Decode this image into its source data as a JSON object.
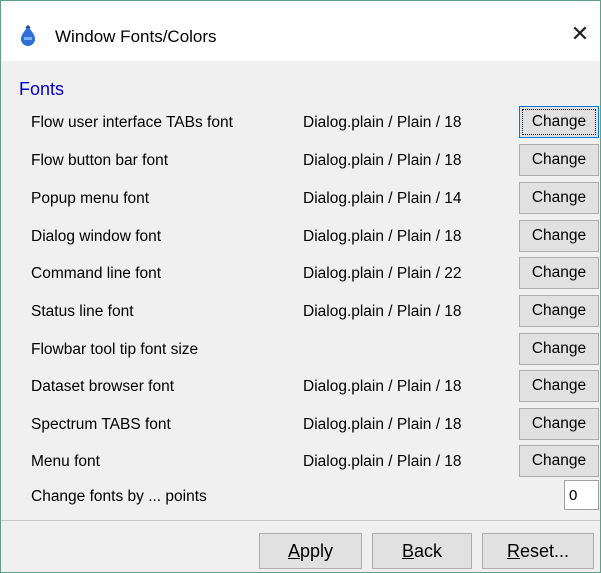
{
  "window": {
    "title": "Window Fonts/Colors",
    "close_glyph": "✕",
    "icon": "droplet-icon"
  },
  "section": {
    "title": "Fonts"
  },
  "rows": [
    {
      "label": "Flow user interface TABs font",
      "value": "Dialog.plain / Plain / 18",
      "button": "Change",
      "focused": true
    },
    {
      "label": "Flow button bar font",
      "value": "Dialog.plain / Plain / 18",
      "button": "Change"
    },
    {
      "label": "Popup menu font",
      "value": "Dialog.plain / Plain / 14",
      "button": "Change"
    },
    {
      "label": "Dialog window font",
      "value": "Dialog.plain / Plain / 18",
      "button": "Change"
    },
    {
      "label": "Command line font",
      "value": "Dialog.plain / Plain / 22",
      "button": "Change"
    },
    {
      "label": "Status line font",
      "value": "Dialog.plain / Plain / 18",
      "button": "Change"
    },
    {
      "label": "Flowbar tool tip font size",
      "value": "",
      "button": "Change"
    },
    {
      "label": "Dataset browser font",
      "value": "Dialog.plain / Plain / 18",
      "button": "Change"
    },
    {
      "label": "Spectrum TABS font",
      "value": "Dialog.plain / Plain / 18",
      "button": "Change"
    },
    {
      "label": "Menu font",
      "value": "Dialog.plain / Plain / 18",
      "button": "Change"
    }
  ],
  "points": {
    "label": "Change fonts by ... points",
    "value": "0"
  },
  "footer": {
    "apply": {
      "mnemonic": "A",
      "rest": "pply"
    },
    "back": {
      "mnemonic": "B",
      "rest": "ack"
    },
    "reset": {
      "mnemonic": "R",
      "rest": "eset..."
    }
  },
  "colors": {
    "section_title": "#0000c8",
    "window_border": "#5f9f86",
    "content_bg": "#f0f0f0",
    "button_bg": "#e1e1e1",
    "icon_blue": "#2f6fd6"
  }
}
